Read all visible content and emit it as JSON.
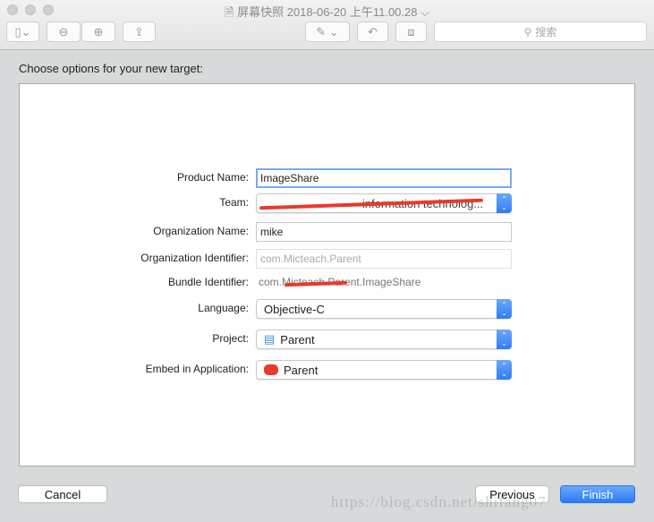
{
  "window": {
    "title": "屏幕快照 2018-06-20 上午11.00.28",
    "search_placeholder": "搜索"
  },
  "sheet": {
    "heading": "Choose options for your new target:",
    "fields": {
      "product_name": {
        "label": "Product Name:",
        "value": "ImageShare"
      },
      "team": {
        "label": "Team:",
        "value": "information technolog..."
      },
      "organization_name": {
        "label": "Organization Name:",
        "value": "mike"
      },
      "organization_identifier": {
        "label": "Organization Identifier:",
        "placeholder": "com.Micteach.Parent"
      },
      "bundle_identifier": {
        "label": "Bundle Identifier:",
        "value": "com.Micteach.Parent.ImageShare"
      },
      "language": {
        "label": "Language:",
        "value": "Objective-C"
      },
      "project": {
        "label": "Project:",
        "value": "Parent",
        "icon": "project-file-icon"
      },
      "embed_in_application": {
        "label": "Embed in Application:",
        "value": "Parent",
        "icon": "app-icon"
      }
    },
    "buttons": {
      "cancel": "Cancel",
      "previous": "Previous",
      "finish": "Finish"
    }
  },
  "watermark": "https://blog.csdn.net/shifang07",
  "colors": {
    "accent": "#2f7cf6",
    "redaction": "#e83a2a"
  }
}
